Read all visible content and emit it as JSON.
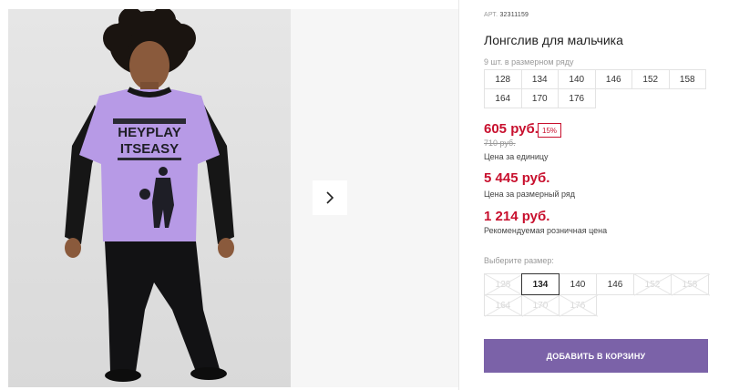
{
  "gallery": {
    "photo_alt": "",
    "shirt_print_lines": [
      "HEYPLAY",
      "ITSEASY"
    ],
    "next_icon": "chevron-right-icon"
  },
  "product": {
    "art_label": "АРТ.",
    "art_number": "32311159",
    "title": "Лонгслив для мальчика",
    "pack_note": "9 шт. в размерном ряду",
    "pack_sizes": [
      [
        "128",
        "134",
        "140",
        "146",
        "152",
        "158"
      ],
      [
        "164",
        "170",
        "176"
      ]
    ],
    "price": "605 руб.",
    "discount_badge": "15%",
    "old_price": "710 руб.",
    "unit_label": "Цена за единицу",
    "pack_price": "5 445 руб.",
    "pack_label": "Цена за размерный ряд",
    "rrp_price": "1 214 руб.",
    "rrp_label": "Рекомендуемая розничная цена",
    "choose_label": "Выберите размер:",
    "size_options": [
      [
        {
          "label": "128",
          "state": "disabled"
        },
        {
          "label": "134",
          "state": "selected"
        },
        {
          "label": "140",
          "state": "available"
        },
        {
          "label": "146",
          "state": "available"
        },
        {
          "label": "152",
          "state": "disabled"
        },
        {
          "label": "158",
          "state": "disabled"
        }
      ],
      [
        {
          "label": "164",
          "state": "disabled"
        },
        {
          "label": "170",
          "state": "disabled"
        },
        {
          "label": "176",
          "state": "disabled"
        }
      ]
    ],
    "cart_button": "ДОБАВИТЬ В КОРЗИНУ"
  },
  "colors": {
    "accent": "#7b62a8",
    "price": "#c8102e",
    "shirt": "#b79ae6",
    "sleeve": "#161616"
  }
}
